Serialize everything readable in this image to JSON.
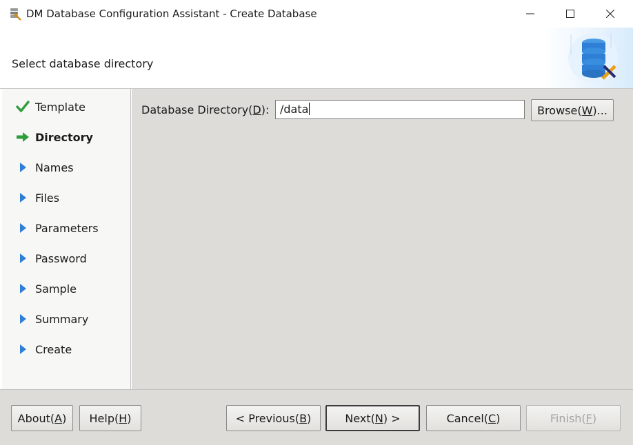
{
  "window": {
    "title": "DM Database Configuration Assistant - Create Database",
    "controls": [
      "minimize-icon",
      "maximize-icon",
      "close-icon"
    ]
  },
  "header": {
    "instruction": "Select database directory",
    "art_icon": "database-wrench-icon"
  },
  "sidebar": {
    "steps": [
      {
        "label": "Template",
        "status": "done",
        "icon": "checkmark-icon"
      },
      {
        "label": "Directory",
        "status": "current",
        "icon": "arrow-right-icon"
      },
      {
        "label": "Names",
        "status": "pending",
        "icon": "triangle-right-icon"
      },
      {
        "label": "Files",
        "status": "pending",
        "icon": "triangle-right-icon"
      },
      {
        "label": "Parameters",
        "status": "pending",
        "icon": "triangle-right-icon"
      },
      {
        "label": "Password",
        "status": "pending",
        "icon": "triangle-right-icon"
      },
      {
        "label": "Sample",
        "status": "pending",
        "icon": "triangle-right-icon"
      },
      {
        "label": "Summary",
        "status": "pending",
        "icon": "triangle-right-icon"
      },
      {
        "label": "Create",
        "status": "pending",
        "icon": "triangle-right-icon"
      }
    ]
  },
  "form": {
    "dir_label": {
      "pre": "Database Directory(",
      "key": "D",
      "post": "):"
    },
    "dir_value": "/data",
    "browse": {
      "pre": "Browse(",
      "key": "W",
      "post": ")..."
    }
  },
  "footer": {
    "about": {
      "pre": "About(",
      "key": "A",
      "post": ")"
    },
    "help": {
      "pre": "Help(",
      "key": "H",
      "post": ")"
    },
    "previous": {
      "pre": "< Previous(",
      "key": "B",
      "post": ")"
    },
    "next": {
      "pre": "Next(",
      "key": "N",
      "post": ") >"
    },
    "cancel": {
      "pre": "Cancel(",
      "key": "C",
      "post": ")"
    },
    "finish": {
      "pre": "Finish(",
      "key": "F",
      "post": ")",
      "enabled": false
    }
  },
  "colors": {
    "check_green": "#2e9d3c",
    "arrow_green": "#2e9d3c",
    "triangle_blue": "#2f7fd6",
    "content_bg": "#dddcd8",
    "sidebar_bg": "#f7f7f5"
  }
}
